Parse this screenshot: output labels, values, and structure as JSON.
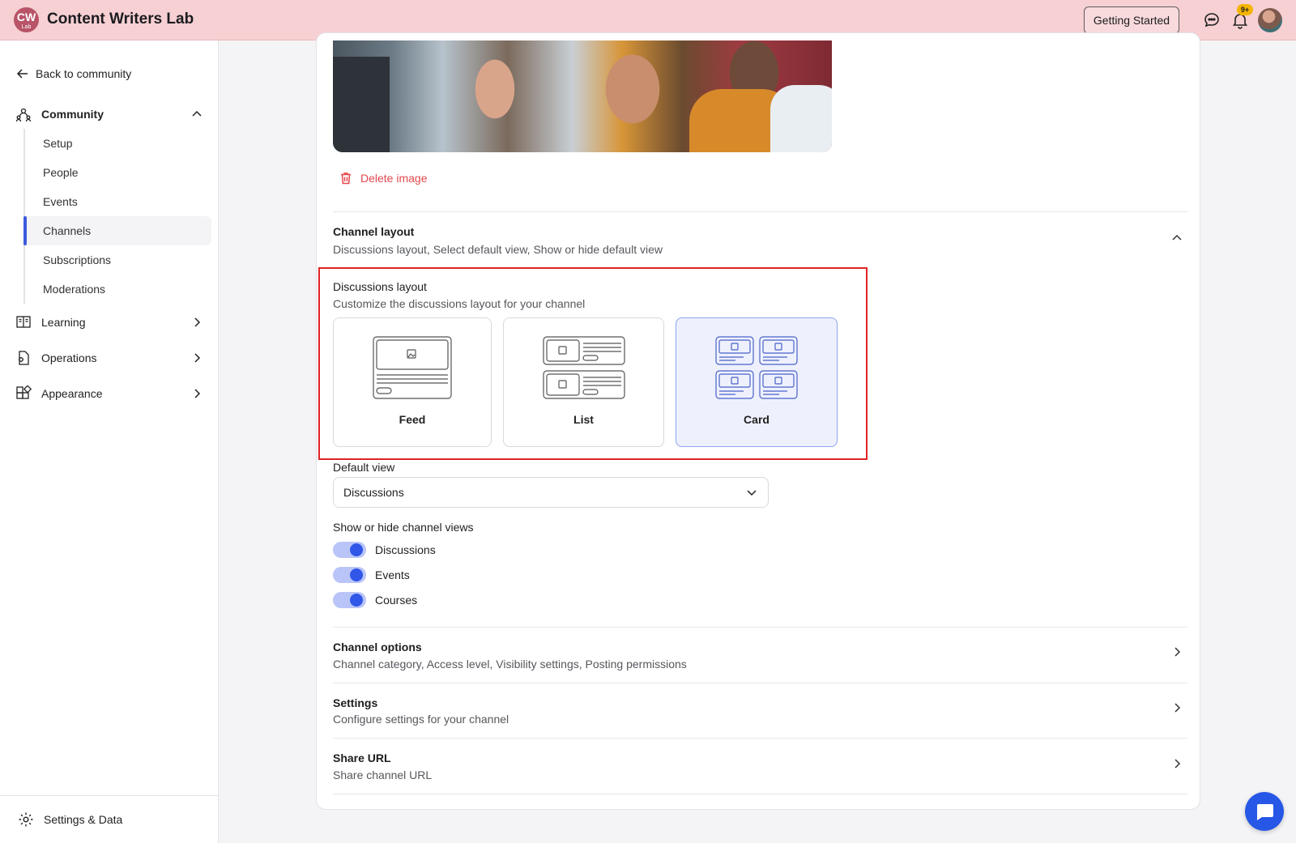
{
  "header": {
    "logo_text": "CW",
    "logo_sub": "Lab",
    "title": "Content Writers Lab",
    "getting_started": "Getting Started",
    "notifications_badge": "9+",
    "brand_color": "#f6d0d3"
  },
  "sidebar": {
    "back": "Back to community",
    "community": "Community",
    "sub_items": [
      "Setup",
      "People",
      "Events",
      "Channels",
      "Subscriptions",
      "Moderations"
    ],
    "active_sub_item": "Channels",
    "learning": "Learning",
    "operations": "Operations",
    "appearance": "Appearance",
    "footer": "Settings & Data",
    "accent_color": "#3b5bdb"
  },
  "main": {
    "delete_image": "Delete image",
    "channel_layout": {
      "title": "Channel layout",
      "subtitle": "Discussions layout, Select default view, Show or hide default view"
    },
    "discussions_layout": {
      "title": "Discussions layout",
      "subtitle": "Customize the discussions layout for your channel",
      "options": [
        "Feed",
        "List",
        "Card"
      ],
      "selected": "Card"
    },
    "default_view": {
      "label": "Default view",
      "value": "Discussions"
    },
    "channel_views": {
      "label": "Show or hide channel views",
      "items": [
        {
          "label": "Discussions",
          "on": true
        },
        {
          "label": "Events",
          "on": true
        },
        {
          "label": "Courses",
          "on": true
        }
      ]
    },
    "channel_options": {
      "title": "Channel options",
      "subtitle": "Channel category, Access level, Visibility settings, Posting permissions"
    },
    "settings": {
      "title": "Settings",
      "subtitle": "Configure settings for your channel"
    },
    "share_url": {
      "title": "Share URL",
      "subtitle": "Share channel URL"
    }
  }
}
